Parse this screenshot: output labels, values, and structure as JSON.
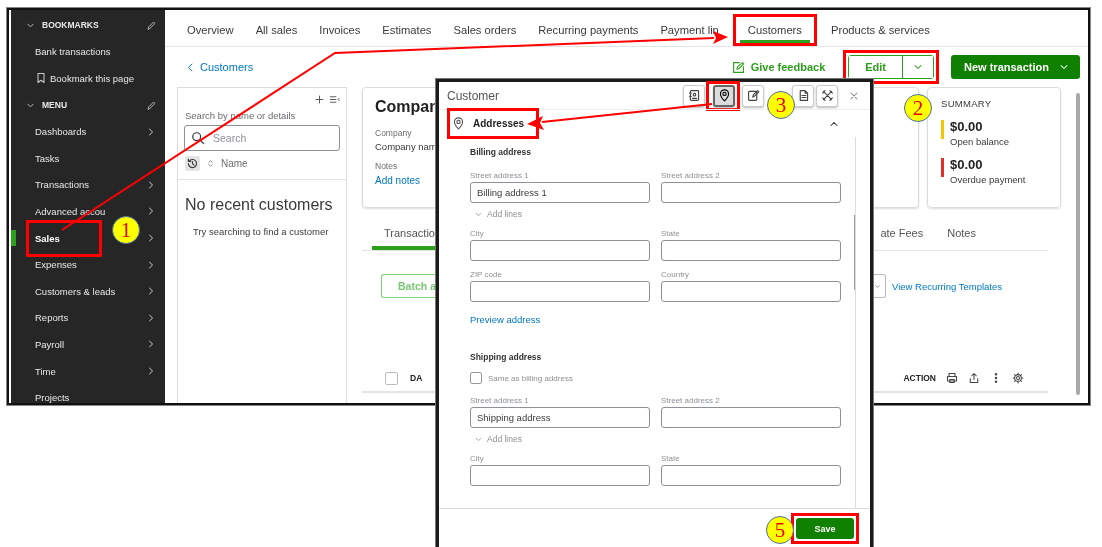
{
  "sidebar": {
    "sections": [
      {
        "title": "BOOKMARKS",
        "expanded": true,
        "items": [
          {
            "label": "Bank transactions",
            "kind": "link",
            "submenu": false,
            "selected": false,
            "highlighted": false
          },
          {
            "label": "Bookmark this page",
            "kind": "bookmark",
            "submenu": false,
            "selected": false,
            "highlighted": false
          }
        ]
      },
      {
        "title": "MENU",
        "expanded": true,
        "items": [
          {
            "label": "Dashboards",
            "kind": "link",
            "submenu": true,
            "selected": false,
            "highlighted": false
          },
          {
            "label": "Tasks",
            "kind": "link",
            "submenu": false,
            "selected": false,
            "highlighted": false
          },
          {
            "label": "Transactions",
            "kind": "link",
            "submenu": true,
            "selected": false,
            "highlighted": false
          },
          {
            "label": "Advanced accou",
            "kind": "link",
            "submenu": true,
            "selected": false,
            "highlighted": false
          },
          {
            "label": "Sales",
            "kind": "link",
            "submenu": true,
            "selected": true,
            "highlighted": true
          },
          {
            "label": "Expenses",
            "kind": "link",
            "submenu": true,
            "selected": false,
            "highlighted": false
          },
          {
            "label": "Customers & leads",
            "kind": "link",
            "submenu": true,
            "selected": false,
            "highlighted": false
          },
          {
            "label": "Reports",
            "kind": "link",
            "submenu": true,
            "selected": false,
            "highlighted": false
          },
          {
            "label": "Payroll",
            "kind": "link",
            "submenu": true,
            "selected": false,
            "highlighted": false
          },
          {
            "label": "Time",
            "kind": "link",
            "submenu": true,
            "selected": false,
            "highlighted": false
          },
          {
            "label": "Projects",
            "kind": "link",
            "submenu": false,
            "selected": false,
            "highlighted": false
          }
        ]
      }
    ]
  },
  "tabs": [
    {
      "label": "Overview",
      "selected": false,
      "highlighted": false
    },
    {
      "label": "All sales",
      "selected": false,
      "highlighted": false
    },
    {
      "label": "Invoices",
      "selected": false,
      "highlighted": false
    },
    {
      "label": "Estimates",
      "selected": false,
      "highlighted": false
    },
    {
      "label": "Sales orders",
      "selected": false,
      "highlighted": false
    },
    {
      "label": "Recurring payments",
      "selected": false,
      "highlighted": false
    },
    {
      "label": "Payment lin",
      "selected": false,
      "highlighted": false
    },
    {
      "label": "Customers",
      "selected": true,
      "highlighted": true
    },
    {
      "label": "Products & services",
      "selected": false,
      "highlighted": false
    }
  ],
  "header": {
    "back_link": "Customers",
    "feedback_link": "Give feedback",
    "edit_button": {
      "label": "Edit",
      "highlighted": true
    },
    "new_button": "New transaction"
  },
  "customer_list": {
    "search_label": "Search by name or details",
    "search": {
      "placeholder": "Search"
    },
    "sort_label": "Name",
    "empty_title": "No recent customers",
    "empty_hint": "Try searching to find a customer"
  },
  "company_card": {
    "title": "Compan",
    "company_label": "Company",
    "company_value": "Company nam",
    "notes_label": "Notes",
    "notes_link": "Add notes"
  },
  "summary": {
    "title": "SUMMARY",
    "items": [
      {
        "amount": "$0.00",
        "label": "Open balance",
        "color": "#f5c400"
      },
      {
        "amount": "$0.00",
        "label": "Overdue payment",
        "color": "#e0302b"
      }
    ]
  },
  "detail_tabs": [
    {
      "label": "Transactio",
      "selected": true
    },
    {
      "label": "ate Fees",
      "selected": false
    },
    {
      "label": "Notes",
      "selected": false
    }
  ],
  "actions": {
    "batch_button": "Batch a",
    "recurring_link": "View Recurring Templates"
  },
  "table": {
    "select_all": {
      "checked": false
    },
    "columns": [
      "DA",
      "ACTION"
    ]
  },
  "dialog": {
    "title": "Customer",
    "toolbar": [
      {
        "kind": "contact",
        "selected": false,
        "highlighted": false
      },
      {
        "kind": "pin",
        "selected": true,
        "highlighted": true
      },
      {
        "kind": "note",
        "selected": false,
        "highlighted": false
      },
      {
        "kind": "document",
        "selected": false,
        "highlighted": false
      },
      {
        "kind": "tools",
        "selected": false,
        "highlighted": false
      }
    ],
    "section": {
      "title": "Addresses",
      "expanded": true,
      "highlighted": true
    },
    "billing": {
      "title": "Billing address",
      "street_fields": [
        {
          "label": "Street address 1",
          "value": "Billing address 1"
        },
        {
          "label": "Street address 2"
        }
      ],
      "add_lines": "Add lines",
      "fields": [
        {
          "label": "City"
        },
        {
          "label": "State"
        },
        {
          "label": "ZIP code"
        },
        {
          "label": "Country"
        }
      ],
      "preview_link": "Preview address"
    },
    "shipping": {
      "title": "Shipping address",
      "same_as_billing": {
        "label": "Same as billing address",
        "checked": false
      },
      "street_fields": [
        {
          "label": "Street address 1",
          "value": "Shipping address"
        },
        {
          "label": "Street address 2"
        }
      ],
      "add_lines": "Add lines",
      "fields": [
        {
          "label": "City"
        },
        {
          "label": "State"
        }
      ]
    },
    "save_button": {
      "label": "Save",
      "highlighted": true
    }
  },
  "callouts": [
    {
      "number": "1"
    },
    {
      "number": "2"
    },
    {
      "number": "3"
    },
    {
      "number": "5"
    }
  ]
}
